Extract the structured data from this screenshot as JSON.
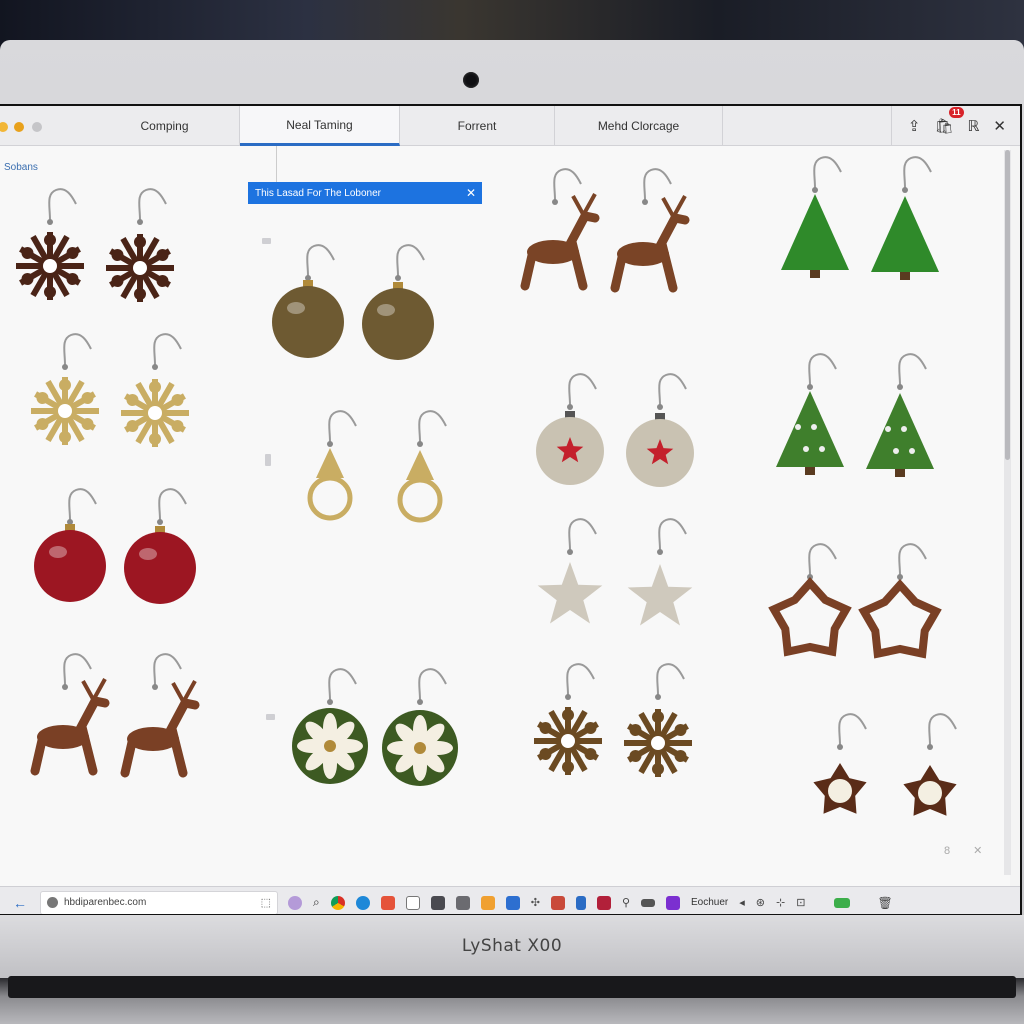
{
  "browser": {
    "tabs": [
      {
        "label": "Comping",
        "active": false
      },
      {
        "label": "Neal Taming",
        "active": true
      },
      {
        "label": "Forrent",
        "active": false
      },
      {
        "label": "Mehd Clorcage",
        "active": false
      }
    ],
    "notification_count": "11",
    "actions": [
      "share-icon",
      "notification-icon",
      "reader-icon",
      "close-icon"
    ]
  },
  "page": {
    "sidebar_label": "Sobans",
    "search_banner": {
      "text": "This Lasad For The Loboner",
      "close": "✕"
    },
    "footer_glyphs": "8 ✕"
  },
  "earrings": [
    {
      "kind": "snowflake",
      "finish": "dark-brown"
    },
    {
      "kind": "bauble",
      "finish": "bronze"
    },
    {
      "kind": "reindeer",
      "finish": "glitter-brown"
    },
    {
      "kind": "tree",
      "finish": "green"
    },
    {
      "kind": "snowflake",
      "finish": "gold"
    },
    {
      "kind": "ring-charm",
      "finish": "gold"
    },
    {
      "kind": "bauble-star",
      "finish": "silver-red"
    },
    {
      "kind": "tree-dotted",
      "finish": "glitter-green"
    },
    {
      "kind": "bauble",
      "finish": "red"
    },
    {
      "kind": "star",
      "finish": "silver-glitter"
    },
    {
      "kind": "star-outline",
      "finish": "brown"
    },
    {
      "kind": "reindeer",
      "finish": "brown"
    },
    {
      "kind": "flower",
      "finish": "green-white"
    },
    {
      "kind": "snowflake",
      "finish": "brown-gold"
    },
    {
      "kind": "star-flower",
      "finish": "white-brown"
    }
  ],
  "taskbar": {
    "url": "hbdiparenbec.com",
    "app_label": "Eochuer"
  },
  "device": {
    "brand": "LyShat X00"
  },
  "colors": {
    "accent": "#1d73e0",
    "dark_brown": "#4a2417",
    "gold": "#c9ad63",
    "red": "#9c1622",
    "green": "#2f8a2a",
    "silver": "#c9c2b2"
  }
}
